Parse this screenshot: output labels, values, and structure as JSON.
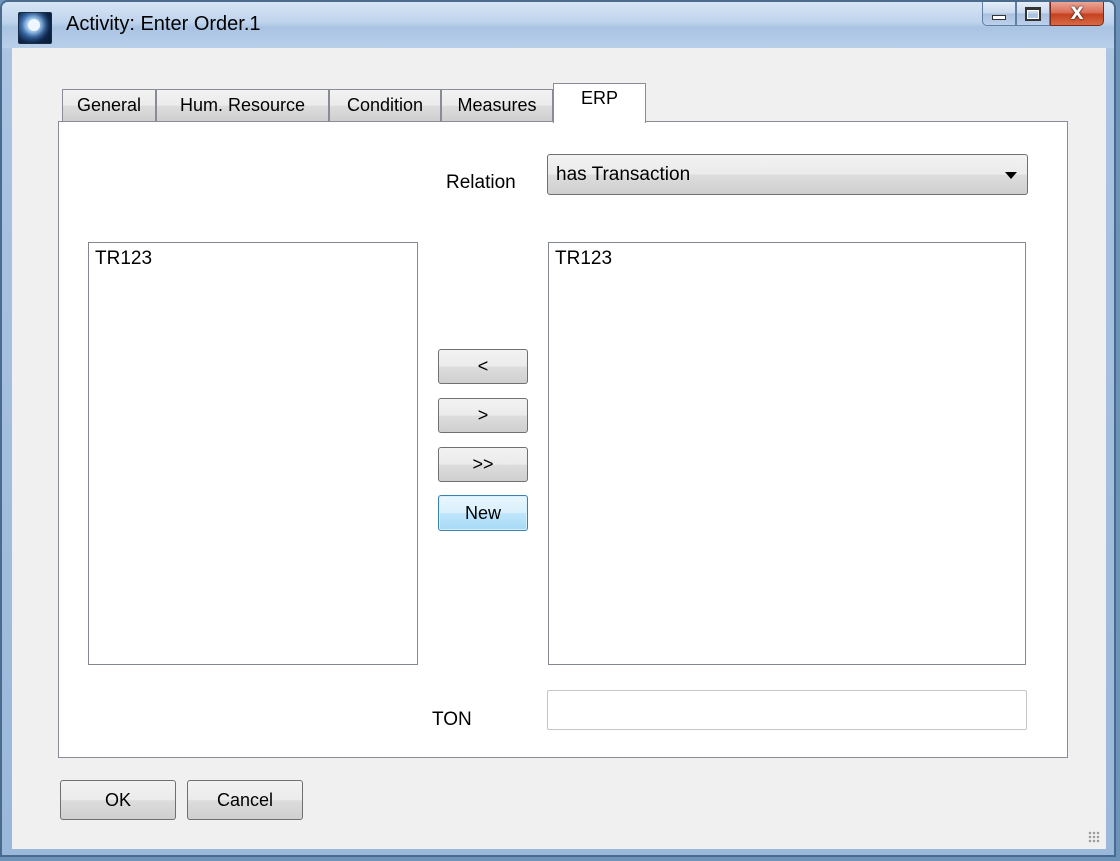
{
  "window": {
    "title": "Activity: Enter Order.1",
    "controls": {
      "minimize": "minimize",
      "maximize": "maximize",
      "close": "X"
    }
  },
  "tabs": [
    {
      "label": "General",
      "active": false
    },
    {
      "label": "Hum. Resource",
      "active": false
    },
    {
      "label": "Condition",
      "active": false
    },
    {
      "label": "Measures",
      "active": false
    },
    {
      "label": "ERP",
      "active": true
    }
  ],
  "erp": {
    "relation_label": "Relation",
    "relation_value": "has Transaction",
    "left_list": [
      "TR123"
    ],
    "right_list": [
      "TR123"
    ],
    "buttons": {
      "move_left": "<",
      "move_right": ">",
      "move_all": ">>",
      "new": "New"
    },
    "ton_label": "TON",
    "ton_value": ""
  },
  "footer": {
    "ok_label": "OK",
    "cancel_label": "Cancel"
  }
}
